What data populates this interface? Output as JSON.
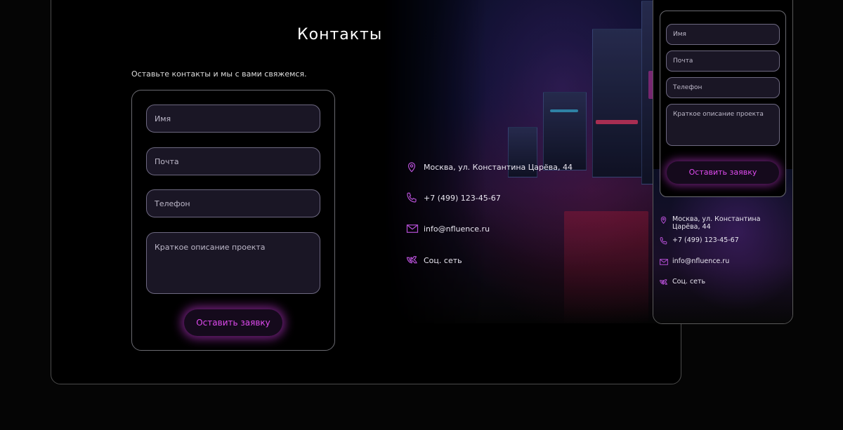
{
  "desktop": {
    "title": "Контакты",
    "subtitle": "Оставьте контакты и мы с вами свяжемся.",
    "form": {
      "name_placeholder": "Имя",
      "email_placeholder": "Почта",
      "phone_placeholder": "Телефон",
      "description_placeholder": "Краткое описание проекта",
      "submit_label": "Оставить заявку"
    },
    "contacts": {
      "address": "Москва, ул. Константина Царёва, 44",
      "phone": "+7 (499) 123-45-67",
      "email": "info@nfluence.ru",
      "social": "Соц. сеть"
    }
  },
  "mobile": {
    "form": {
      "name_placeholder": "Имя",
      "email_placeholder": "Почта",
      "phone_placeholder": "Телефон",
      "description_placeholder": "Краткое описание проекта",
      "submit_label": "Оставить заявку"
    },
    "contacts": {
      "address": "Москва, ул. Константина Царёва, 44",
      "phone": "+7 (499) 123-45-67",
      "email": "info@nfluence.ru",
      "social": "Соц. сеть"
    }
  },
  "icons": {
    "location": "location-pin-icon",
    "phone": "phone-icon",
    "email": "mail-icon",
    "social": "vk-icon"
  },
  "colors": {
    "accent": "#e04bf0",
    "icon": "#b44fd4",
    "background": "#000000"
  }
}
